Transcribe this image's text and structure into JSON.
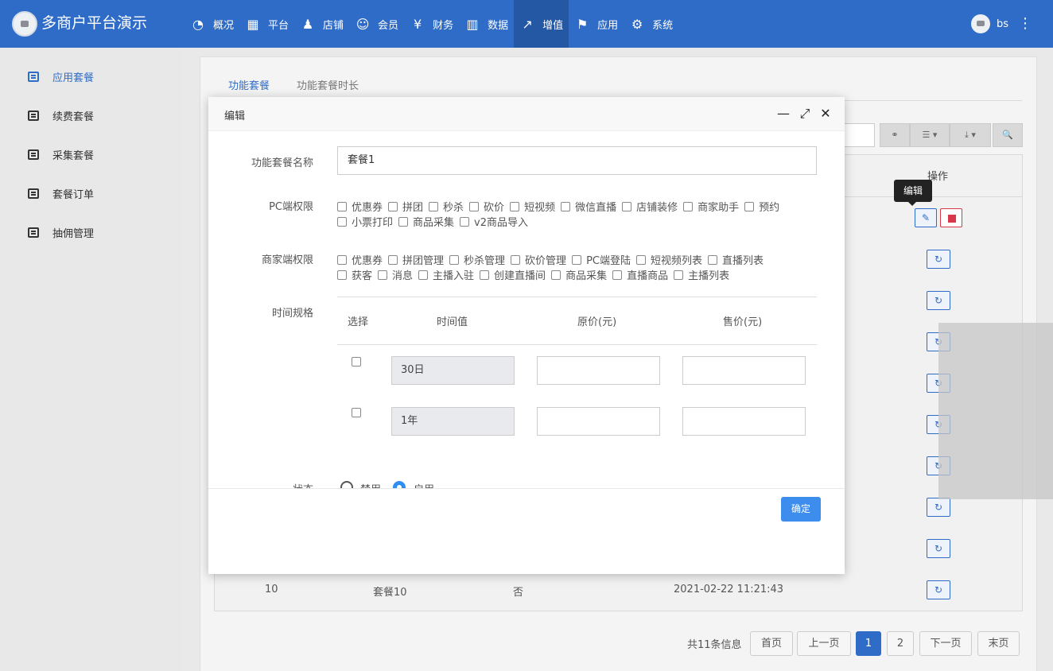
{
  "app": {
    "title": "多商户平台演示",
    "user": "bs",
    "kebab": "⋮"
  },
  "nav": [
    {
      "label": "概况",
      "icon": "dashboard-icon",
      "glyph": "◔"
    },
    {
      "label": "平台",
      "icon": "grid-icon",
      "glyph": "▦"
    },
    {
      "label": "店铺",
      "icon": "users-icon",
      "glyph": "♟"
    },
    {
      "label": "会员",
      "icon": "user-plus-icon",
      "glyph": "☺"
    },
    {
      "label": "财务",
      "icon": "yen-icon",
      "glyph": "¥"
    },
    {
      "label": "数据",
      "icon": "bar-chart-icon",
      "glyph": "▥"
    },
    {
      "label": "增值",
      "icon": "line-chart-icon",
      "glyph": "↗"
    },
    {
      "label": "应用",
      "icon": "flag-icon",
      "glyph": "⚑"
    },
    {
      "label": "系统",
      "icon": "gear-icon",
      "glyph": "⚙"
    }
  ],
  "sidebar": {
    "items": [
      {
        "label": "应用套餐"
      },
      {
        "label": "续费套餐"
      },
      {
        "label": "采集套餐"
      },
      {
        "label": "套餐订单"
      },
      {
        "label": "抽佣管理"
      }
    ]
  },
  "tabs": [
    "功能套餐",
    "功能套餐时长"
  ],
  "toolbar": {
    "columns_glyph": "⚭",
    "list_glyph": "☰ ▾",
    "export_glyph": "⤓ ▾",
    "search_glyph": "🔍"
  },
  "table": {
    "ops_header": "操作",
    "tooltip": "编辑",
    "edit_glyph": "✎",
    "refresh_glyph": "↻",
    "last_row": {
      "id": "10",
      "name": "套餐10",
      "flag": "否",
      "time": "2021-02-22 11:21:43"
    }
  },
  "pager": {
    "info": "共11条信息",
    "first": "首页",
    "prev": "上一页",
    "pages": [
      "1",
      "2"
    ],
    "next": "下一页",
    "last": "末页"
  },
  "modal": {
    "title": "编辑",
    "minimize_glyph": "—",
    "maximize_glyph": "⤢",
    "close_glyph": "✕",
    "name_label": "功能套餐名称",
    "name_value": "套餐1",
    "pc_label": "PC端权限",
    "pc_perms_row1": [
      "优惠券",
      "拼团",
      "秒杀",
      "砍价",
      "短视频",
      "微信直播",
      "店铺装修",
      "商家助手",
      "预约"
    ],
    "pc_perms_row2": [
      "小票打印",
      "商品采集",
      "v2商品导入"
    ],
    "merchant_label": "商家端权限",
    "merchant_perms_row1": [
      "优惠券",
      "拼团管理",
      "秒杀管理",
      "砍价管理",
      "PC端登陆",
      "短视频列表",
      "直播列表"
    ],
    "merchant_perms_row2": [
      "获客",
      "消息",
      "主播入驻",
      "创建直播间",
      "商品采集",
      "直播商品",
      "主播列表"
    ],
    "time_label": "时间规格",
    "spec_headers": {
      "select": "选择",
      "time": "时间值",
      "orig": "原价(元)",
      "sale": "售价(元)"
    },
    "spec_rows": [
      {
        "time": "30日"
      },
      {
        "time": "1年"
      }
    ],
    "status_label": "状态",
    "status_options": [
      "禁用",
      "启用"
    ],
    "status_selected": "启用",
    "ok": "确定"
  }
}
